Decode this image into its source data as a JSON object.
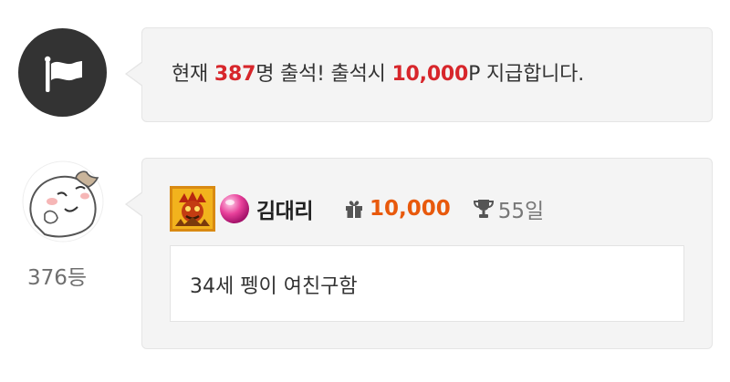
{
  "attendance": {
    "prefix": "현재 ",
    "count": "387",
    "mid": "명 출석! 출석시 ",
    "points": "10,000",
    "suffix": "P 지급합니다."
  },
  "entry": {
    "rank": "376등",
    "nickname": "김대리",
    "points": "10,000",
    "days": "55일",
    "comment": "34세 펭이 여친구함"
  },
  "colors": {
    "highlight": "#d7262b",
    "points": "#e8590c",
    "bubble": "#f4f4f4",
    "flag_circle": "#333333"
  },
  "icons": {
    "flag": "flag-icon",
    "level": "level-badge-icon",
    "gem": "pink-gem-icon",
    "gift": "gift-icon",
    "trophy": "trophy-icon"
  }
}
